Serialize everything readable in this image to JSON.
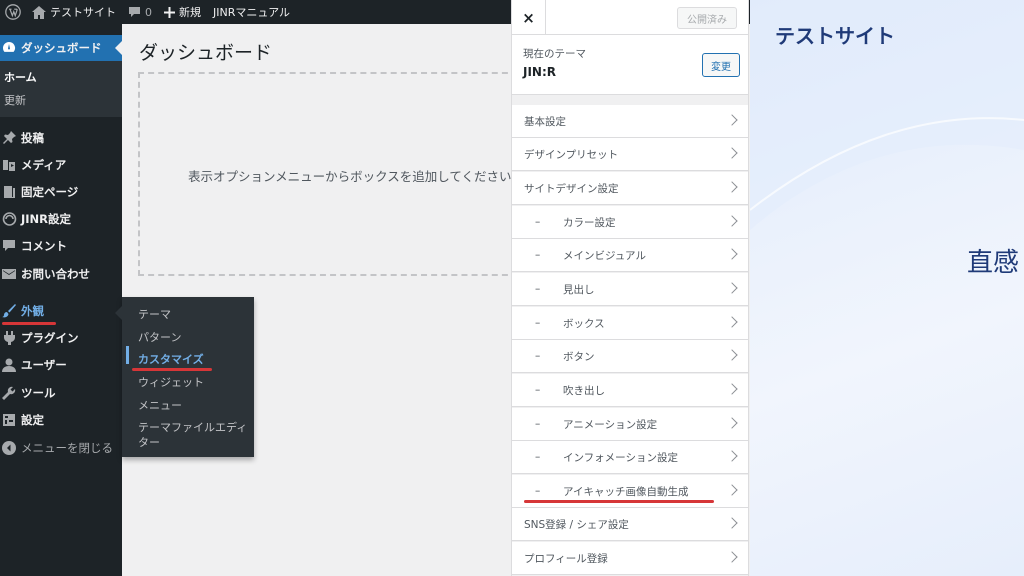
{
  "admin_bar": {
    "site_name": "テストサイト",
    "comments_count": "0",
    "new_label": "新規",
    "manual_label": "JINRマニュアル"
  },
  "sidebar": {
    "dashboard": "ダッシュボード",
    "home": "ホーム",
    "update": "更新",
    "items": [
      {
        "label": "投稿",
        "icon": "pin-icon"
      },
      {
        "label": "メディア",
        "icon": "media-icon"
      },
      {
        "label": "固定ページ",
        "icon": "page-icon"
      },
      {
        "label": "JINR設定",
        "icon": "jinr-icon"
      },
      {
        "label": "コメント",
        "icon": "comment-icon"
      },
      {
        "label": "お問い合わせ",
        "icon": "mail-icon"
      },
      {
        "label": "外観",
        "icon": "brush-icon"
      },
      {
        "label": "プラグイン",
        "icon": "plugin-icon"
      },
      {
        "label": "ユーザー",
        "icon": "user-icon"
      },
      {
        "label": "ツール",
        "icon": "wrench-icon"
      },
      {
        "label": "設定",
        "icon": "settings-icon"
      }
    ],
    "collapse": "メニューを閉じる"
  },
  "flyout": {
    "items": [
      "テーマ",
      "パターン",
      "カスタマイズ",
      "ウィジェット",
      "メニュー",
      "テーマファイルエディ",
      "ター"
    ]
  },
  "main": {
    "title": "ダッシュボード",
    "empty_message": "表示オプションメニューからボックスを追加してください"
  },
  "customizer": {
    "close": "×",
    "published": "公開済み",
    "current_theme_label": "現在のテーマ",
    "theme_name": "JIN:R",
    "change_button": "変更",
    "dash": "–",
    "sections": [
      {
        "label": "基本設定",
        "sub": false
      },
      {
        "label": "デザインプリセット",
        "sub": false
      },
      {
        "label": "サイトデザイン設定",
        "sub": false
      },
      {
        "label": "カラー設定",
        "sub": true
      },
      {
        "label": "メインビジュアル",
        "sub": true
      },
      {
        "label": "見出し",
        "sub": true
      },
      {
        "label": "ボックス",
        "sub": true
      },
      {
        "label": "ボタン",
        "sub": true
      },
      {
        "label": "吹き出し",
        "sub": true
      },
      {
        "label": "アニメーション設定",
        "sub": true
      },
      {
        "label": "インフォメーション設定",
        "sub": true
      },
      {
        "label": "アイキャッチ画像自動生成",
        "sub": true
      },
      {
        "label": "SNS登録 / シェア設定",
        "sub": false
      },
      {
        "label": "プロフィール登録",
        "sub": false
      }
    ]
  },
  "preview": {
    "site_title": "テストサイト",
    "hero_text": "直感"
  },
  "colors": {
    "admin_dark": "#1d2327",
    "accent_blue": "#2271b1",
    "highlight_red": "#d63638",
    "preview_navy": "#1f3a78"
  }
}
